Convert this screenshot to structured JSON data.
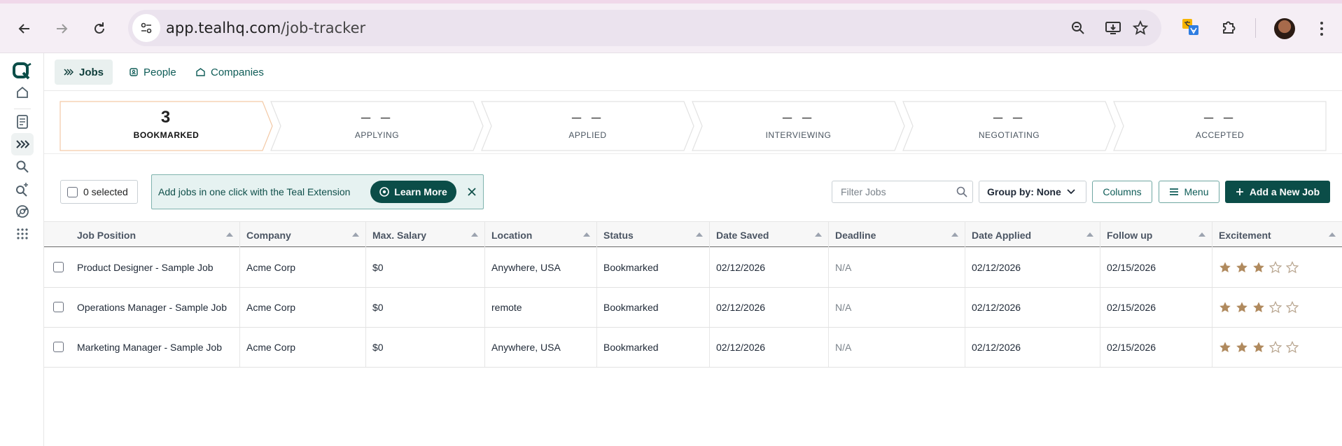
{
  "browser": {
    "url_host": "app.tealhq.com",
    "url_path": "/job-tracker"
  },
  "topnav": {
    "tabs": [
      {
        "label": "Jobs",
        "icon": "chevrons-right-icon",
        "active": true
      },
      {
        "label": "People",
        "icon": "contact-icon",
        "active": false
      },
      {
        "label": "Companies",
        "icon": "building-icon",
        "active": false
      }
    ]
  },
  "pipeline": [
    {
      "count": "3",
      "label": "BOOKMARKED",
      "active": true
    },
    {
      "count": "– –",
      "label": "APPLYING",
      "active": false
    },
    {
      "count": "– –",
      "label": "APPLIED",
      "active": false
    },
    {
      "count": "– –",
      "label": "INTERVIEWING",
      "active": false
    },
    {
      "count": "– –",
      "label": "NEGOTIATING",
      "active": false
    },
    {
      "count": "– –",
      "label": "ACCEPTED",
      "active": false
    }
  ],
  "toolbar": {
    "selected_label": "0 selected",
    "banner_text": "Add jobs in one click with the Teal Extension",
    "learn_more": "Learn More",
    "filter_placeholder": "Filter Jobs",
    "group_by": "Group by: None",
    "columns": "Columns",
    "menu": "Menu",
    "add_job": "Add a New Job"
  },
  "table": {
    "columns": [
      "Job Position",
      "Company",
      "Max. Salary",
      "Location",
      "Status",
      "Date Saved",
      "Deadline",
      "Date Applied",
      "Follow up",
      "Excitement"
    ],
    "rows": [
      {
        "position": "Product Designer - Sample Job",
        "company": "Acme Corp",
        "salary": "$0",
        "location": "Anywhere, USA",
        "status": "Bookmarked",
        "date_saved": "02/12/2026",
        "deadline": "N/A",
        "date_applied": "02/12/2026",
        "follow_up": "02/15/2026",
        "excitement": 3
      },
      {
        "position": "Operations Manager - Sample Job",
        "company": "Acme Corp",
        "salary": "$0",
        "location": "remote",
        "status": "Bookmarked",
        "date_saved": "02/12/2026",
        "deadline": "N/A",
        "date_applied": "02/12/2026",
        "follow_up": "02/15/2026",
        "excitement": 3
      },
      {
        "position": "Marketing Manager - Sample Job",
        "company": "Acme Corp",
        "salary": "$0",
        "location": "Anywhere, USA",
        "status": "Bookmarked",
        "date_saved": "02/12/2026",
        "deadline": "N/A",
        "date_applied": "02/12/2026",
        "follow_up": "02/15/2026",
        "excitement": 3
      }
    ],
    "excitement_max": 5
  },
  "colors": {
    "brand": "#0b4d48",
    "star_filled": "#b08a5e",
    "star_empty": "#b9a690"
  }
}
